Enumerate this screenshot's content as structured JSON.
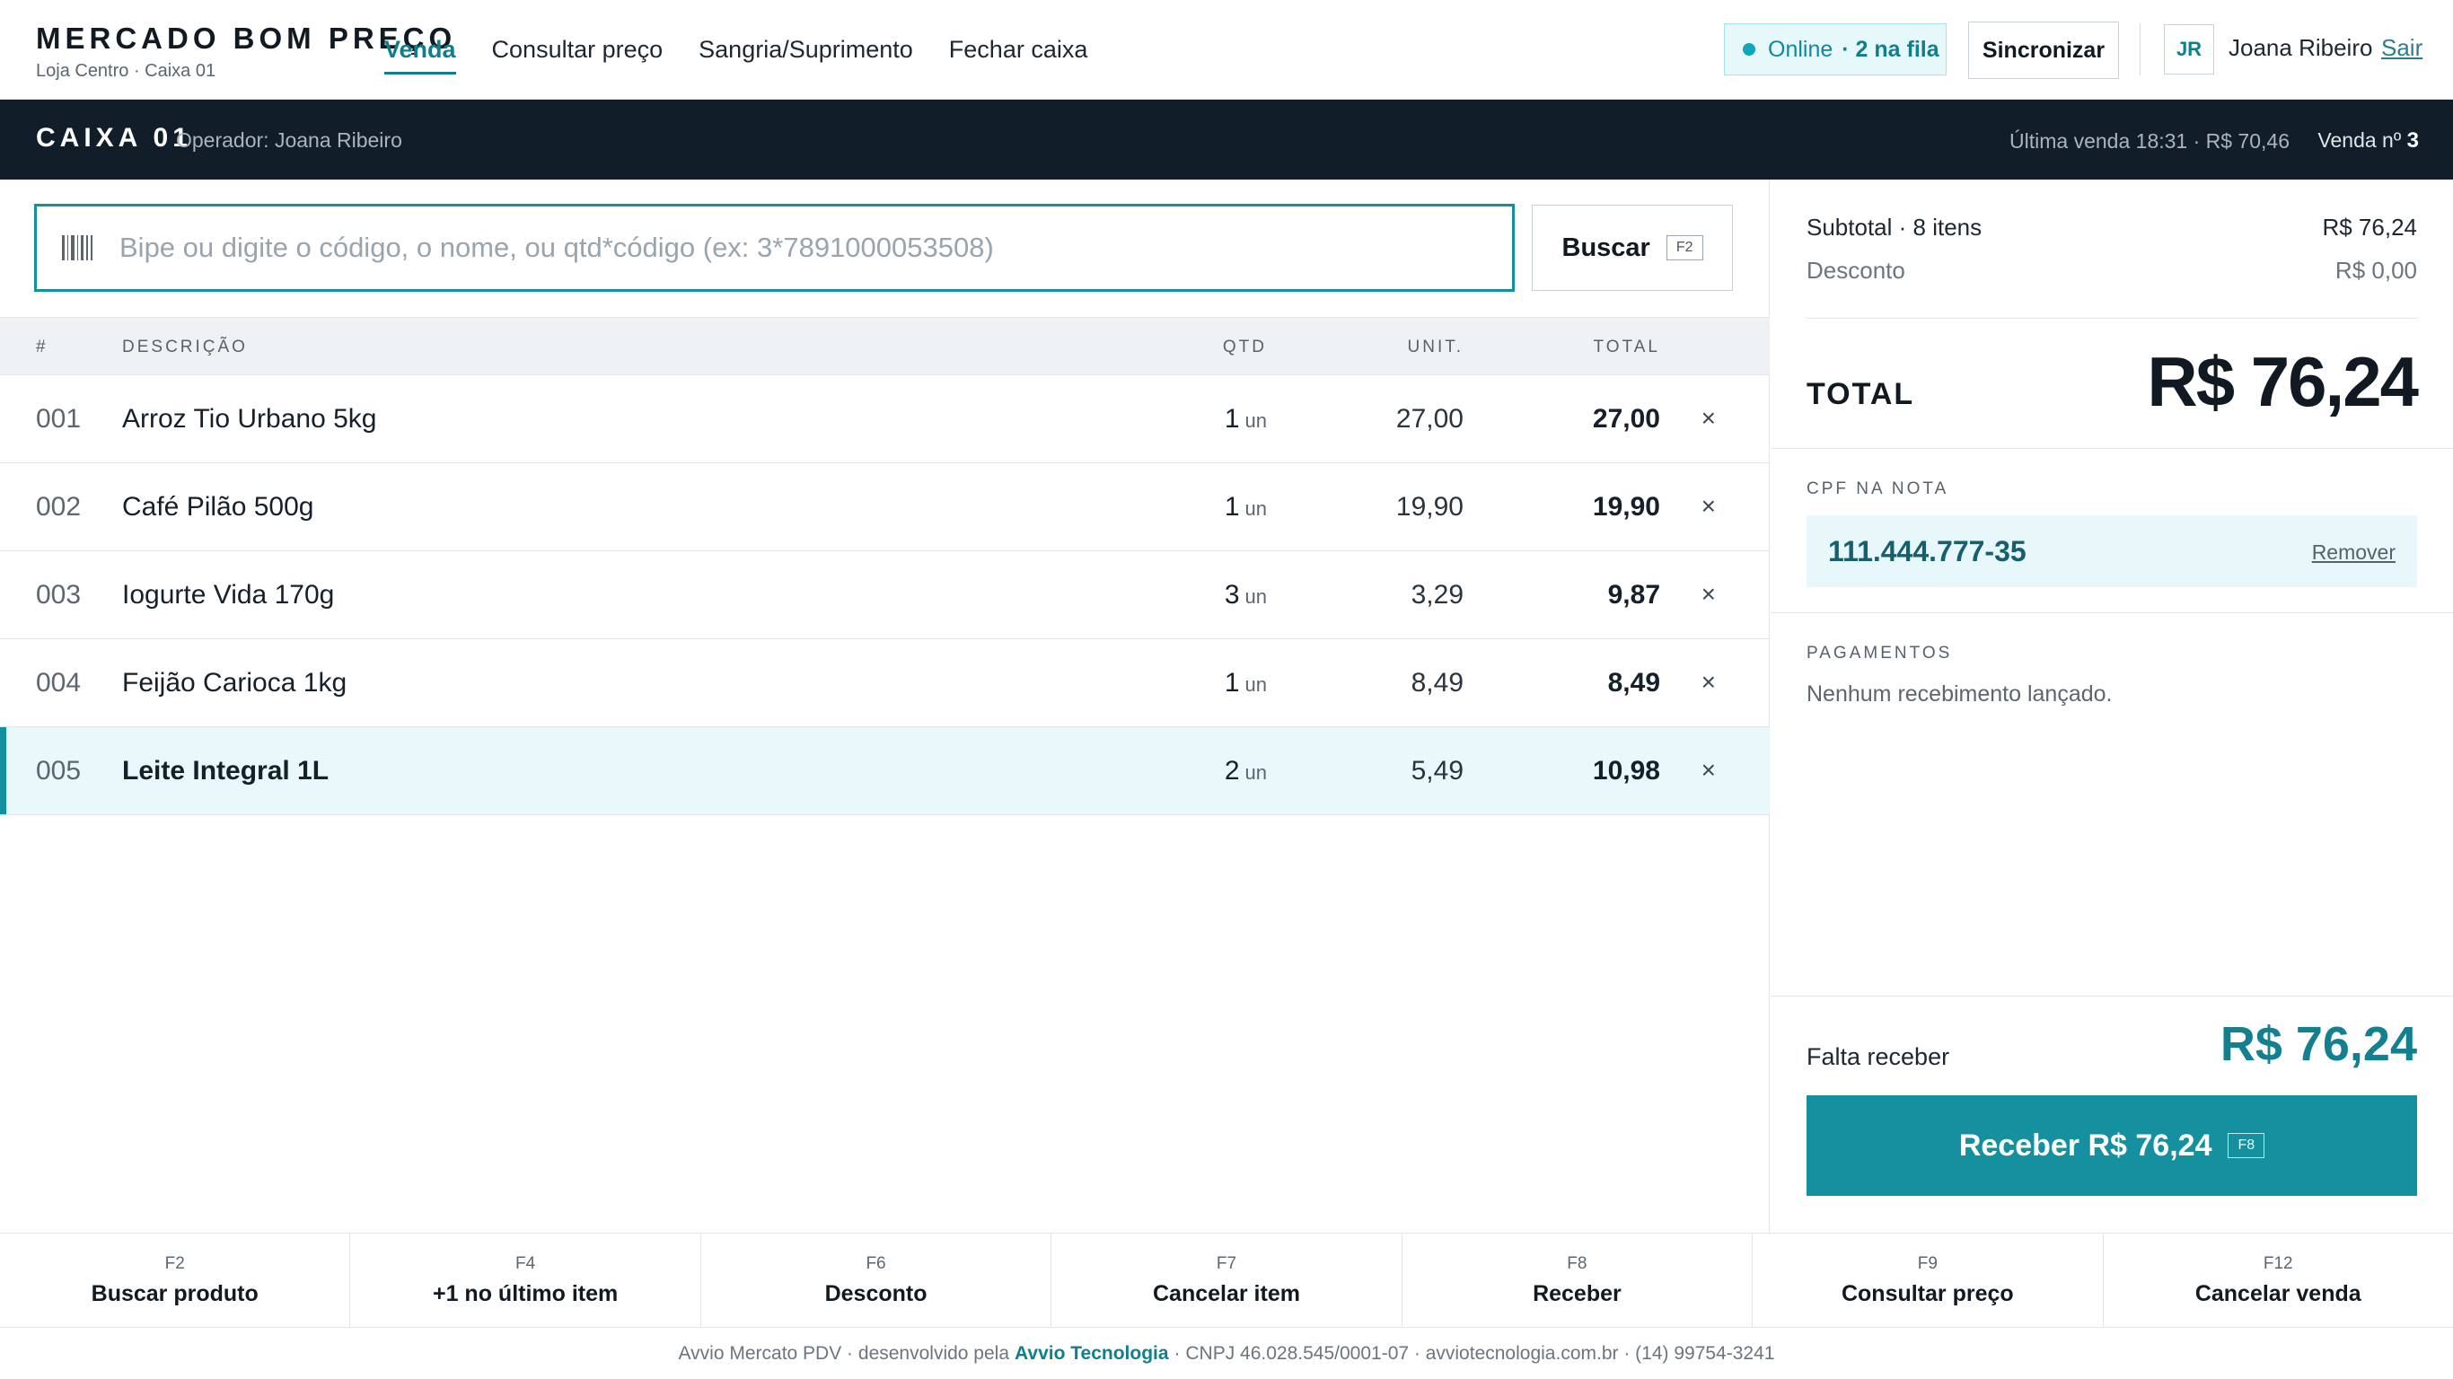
{
  "brand": {
    "name": "MERCADO BOM PREÇO",
    "sub": "Loja Centro · Caixa 01"
  },
  "nav": [
    {
      "label": "Venda",
      "active": true
    },
    {
      "label": "Consultar preço",
      "active": false
    },
    {
      "label": "Sangria/Suprimento",
      "active": false
    },
    {
      "label": "Fechar caixa",
      "active": false
    }
  ],
  "status": {
    "online": "Online",
    "queue": "· 2 na fila"
  },
  "sync_label": "Sincronizar",
  "user": {
    "initials": "JR",
    "name": "Joana Ribeiro",
    "logout": "Sair"
  },
  "register": {
    "label": "CAIXA 01",
    "operator": "Operador: Joana Ribeiro",
    "last_sale": "Última venda 18:31 · R$ 70,46",
    "sale_prefix": "Venda nº",
    "sale_number": "3"
  },
  "search": {
    "placeholder": "Bipe ou digite o código, o nome, ou qtd*código (ex: 3*7891000053508)",
    "button": "Buscar",
    "button_key": "F2"
  },
  "table": {
    "headers": {
      "num": "#",
      "desc": "DESCRIÇÃO",
      "qty": "QTD",
      "unit": "UNIT.",
      "total": "TOTAL"
    },
    "rows": [
      {
        "num": "001",
        "desc": "Arroz Tio Urbano 5kg",
        "qty": "1",
        "uom": "un",
        "unit": "27,00",
        "total": "27,00",
        "remove": "×"
      },
      {
        "num": "002",
        "desc": "Café Pilão 500g",
        "qty": "1",
        "uom": "un",
        "unit": "19,90",
        "total": "19,90",
        "remove": "×"
      },
      {
        "num": "003",
        "desc": "Iogurte Vida 170g",
        "qty": "3",
        "uom": "un",
        "unit": "3,29",
        "total": "9,87",
        "remove": "×"
      },
      {
        "num": "004",
        "desc": "Feijão Carioca 1kg",
        "qty": "1",
        "uom": "un",
        "unit": "8,49",
        "total": "8,49",
        "remove": "×"
      },
      {
        "num": "005",
        "desc": "Leite Integral 1L",
        "qty": "2",
        "uom": "un",
        "unit": "5,49",
        "total": "10,98",
        "remove": "×"
      }
    ]
  },
  "summary": {
    "subtotal_label": "Subtotal · 8 itens",
    "subtotal_value": "R$ 76,24",
    "discount_label": "Desconto",
    "discount_value": "R$ 0,00",
    "total_label": "TOTAL",
    "total_value": "R$ 76,24"
  },
  "cpf": {
    "label": "CPF NA NOTA",
    "value": "111.444.777-35",
    "remove": "Remover"
  },
  "payments": {
    "label": "PAGAMENTOS",
    "empty": "Nenhum recebimento lançado."
  },
  "due": {
    "label": "Falta receber",
    "value": "R$ 76,24",
    "button": "Receber R$ 76,24",
    "button_key": "F8"
  },
  "fkeys": [
    {
      "code": "F2",
      "label": "Buscar produto"
    },
    {
      "code": "F4",
      "label": "+1 no último item"
    },
    {
      "code": "F6",
      "label": "Desconto"
    },
    {
      "code": "F7",
      "label": "Cancelar item"
    },
    {
      "code": "F8",
      "label": "Receber"
    },
    {
      "code": "F9",
      "label": "Consultar preço"
    },
    {
      "code": "F12",
      "label": "Cancelar venda"
    }
  ],
  "footer": {
    "pre": "Avvio Mercato PDV · desenvolvido pela",
    "company": "Avvio Tecnologia",
    "post": "· CNPJ 46.028.545/0001-07 · avviotecnologia.com.br · (14) 99754-3241"
  },
  "colors": {
    "accent": "#13909f",
    "dark_bar": "#111d28",
    "accent_text": "#0f7f8e"
  }
}
